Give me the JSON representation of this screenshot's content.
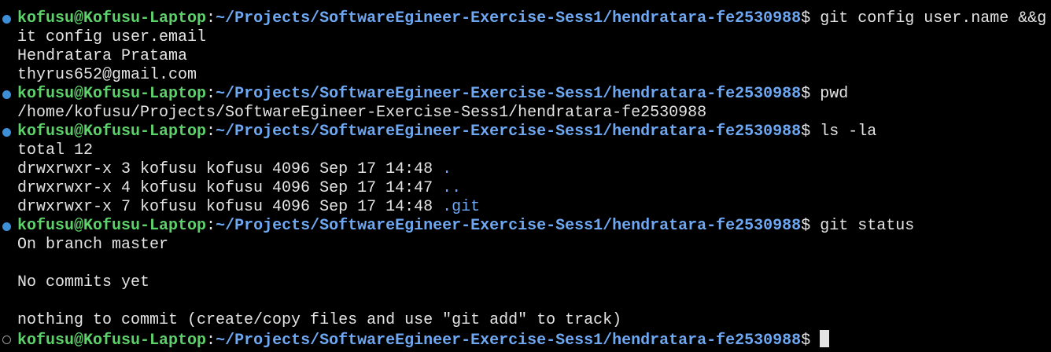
{
  "prompt": {
    "user_host": "kofusu@Kofusu-Laptop",
    "colon": ":",
    "path": "~/Projects/SoftwareEgineer-Exercise-Sess1/hendratara-fe2530988",
    "symbol": "$"
  },
  "colors": {
    "background": "#000000",
    "text": "#e4e4e4",
    "prompt_user": "#5dd16a",
    "prompt_path": "#6ea8f2",
    "marker_success": "#3c8fd6",
    "marker_pending": "#9a9a9a"
  },
  "blocks": [
    {
      "status": "success",
      "command": " git config user.name &&g",
      "output": [
        "it config user.email",
        "Hendratara Pratama",
        "thyrus652@gmail.com"
      ]
    },
    {
      "status": "success",
      "command": " pwd",
      "output": [
        "/home/kofusu/Projects/SoftwareEgineer-Exercise-Sess1/hendratara-fe2530988"
      ]
    },
    {
      "status": "success",
      "command": " ls -la",
      "output": [
        "total 12"
      ],
      "listing": [
        {
          "meta": "drwxrwxr-x 3 kofusu kofusu 4096 Sep 17 14:48 ",
          "name": "."
        },
        {
          "meta": "drwxrwxr-x 4 kofusu kofusu 4096 Sep 17 14:47 ",
          "name": ".."
        },
        {
          "meta": "drwxrwxr-x 7 kofusu kofusu 4096 Sep 17 14:48 ",
          "name": ".git"
        }
      ]
    },
    {
      "status": "success",
      "command": " git status",
      "output": [
        "On branch master",
        "",
        "No commits yet",
        "",
        "nothing to commit (create/copy files and use \"git add\" to track)"
      ]
    },
    {
      "status": "pending",
      "command": " ",
      "output": []
    }
  ]
}
